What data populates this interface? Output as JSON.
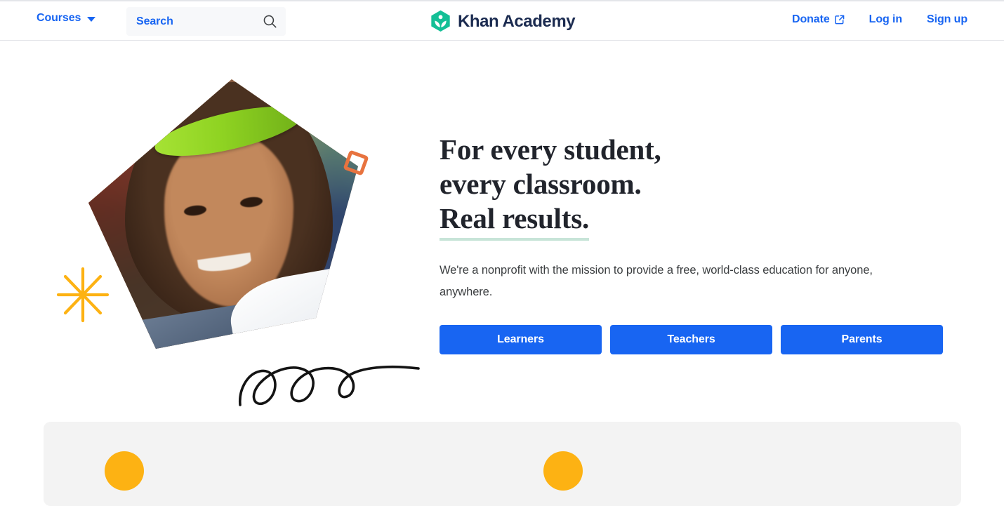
{
  "colors": {
    "brand_blue": "#1865f2",
    "brand_green": "#14bf96",
    "brand_navy": "#1b2b50",
    "headline": "#21242c",
    "underline_mint": "#c7e4d8",
    "accent_orange": "#e8733f",
    "accent_yellow": "#fdb213",
    "card_gray": "#f3f3f3",
    "search_bg": "#f7f8fa",
    "border_gray": "#e3e5e9"
  },
  "header": {
    "courses_label": "Courses",
    "courses_icon": "chevron-down-icon",
    "search": {
      "placeholder": "Search",
      "value": "",
      "icon": "search-icon"
    },
    "brand": {
      "name": "Khan Academy",
      "logo_icon": "khan-academy-leaf-hexagon-logo"
    },
    "links": [
      {
        "label": "Donate",
        "icon": "external-link-icon",
        "has_icon": true
      },
      {
        "label": "Log in",
        "icon": "",
        "has_icon": false
      },
      {
        "label": "Sign up",
        "icon": "",
        "has_icon": false
      }
    ]
  },
  "hero": {
    "photo": {
      "alt": "Smiling student wearing a neon green headband at a laptop",
      "shape": "rotated-pentagon"
    },
    "decorations": [
      {
        "name": "starburst-decoration",
        "shape": "eight-point-starburst",
        "color": "#fdb213"
      },
      {
        "name": "square-decoration",
        "shape": "rotated-square-outline",
        "color": "#e8733f"
      },
      {
        "name": "squiggle-decoration",
        "shape": "three-loop-scribble",
        "color": "#141414"
      }
    ],
    "headline_line_1": "For every student,",
    "headline_line_2": "every classroom.",
    "headline_line_3": "Real results.",
    "subtext_line_1": "We're a nonprofit with the mission to provide a free, world-class education",
    "subtext_line_2": "for anyone, anywhere.",
    "buttons": [
      {
        "label": "Learners"
      },
      {
        "label": "Teachers"
      },
      {
        "label": "Parents"
      }
    ]
  },
  "bottom_card": {
    "dots": [
      {
        "name": "card-dot-1",
        "color": "#fdb213"
      },
      {
        "name": "card-dot-2",
        "color": "#fdb213"
      }
    ]
  }
}
